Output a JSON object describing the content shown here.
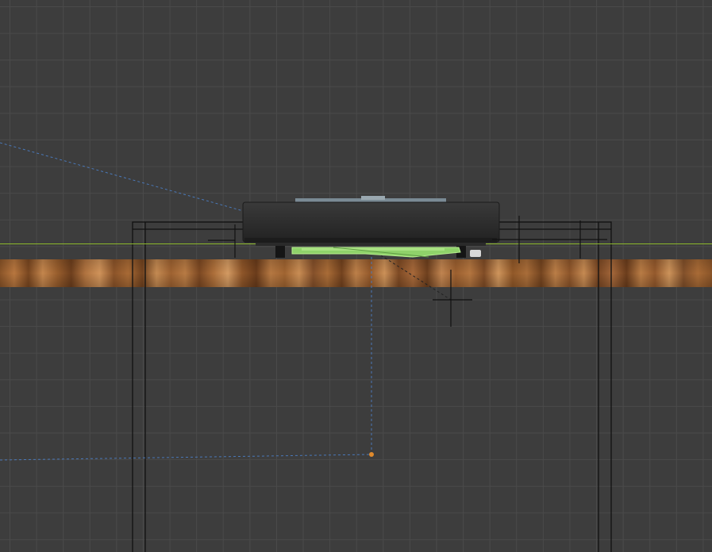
{
  "viewport": {
    "mode": "3d-viewport",
    "view": "front-orthographic",
    "grid": true,
    "background_color": "#3d3d3d",
    "grid_color": "#4a4a4a",
    "axis_color": "#8db82c"
  },
  "scene": {
    "objects": [
      {
        "kind": "wood-floor-plane",
        "name": "floor",
        "material_colors": [
          "#8a5428",
          "#c4864d",
          "#6e3f1d"
        ]
      },
      {
        "kind": "device-body",
        "name": "dark-device",
        "color": "#2c2c2c"
      },
      {
        "kind": "selected-part",
        "name": "green-base",
        "color": "#8fd26a"
      },
      {
        "kind": "camera-frame",
        "name": "camera-bounds",
        "color": "#111111"
      },
      {
        "kind": "empty",
        "name": "empty-cross-1"
      },
      {
        "kind": "empty",
        "name": "empty-cross-2"
      },
      {
        "kind": "light",
        "name": "light-origin",
        "color": "#e08a2c"
      }
    ],
    "relationship_line_color": "#4a78b8"
  }
}
